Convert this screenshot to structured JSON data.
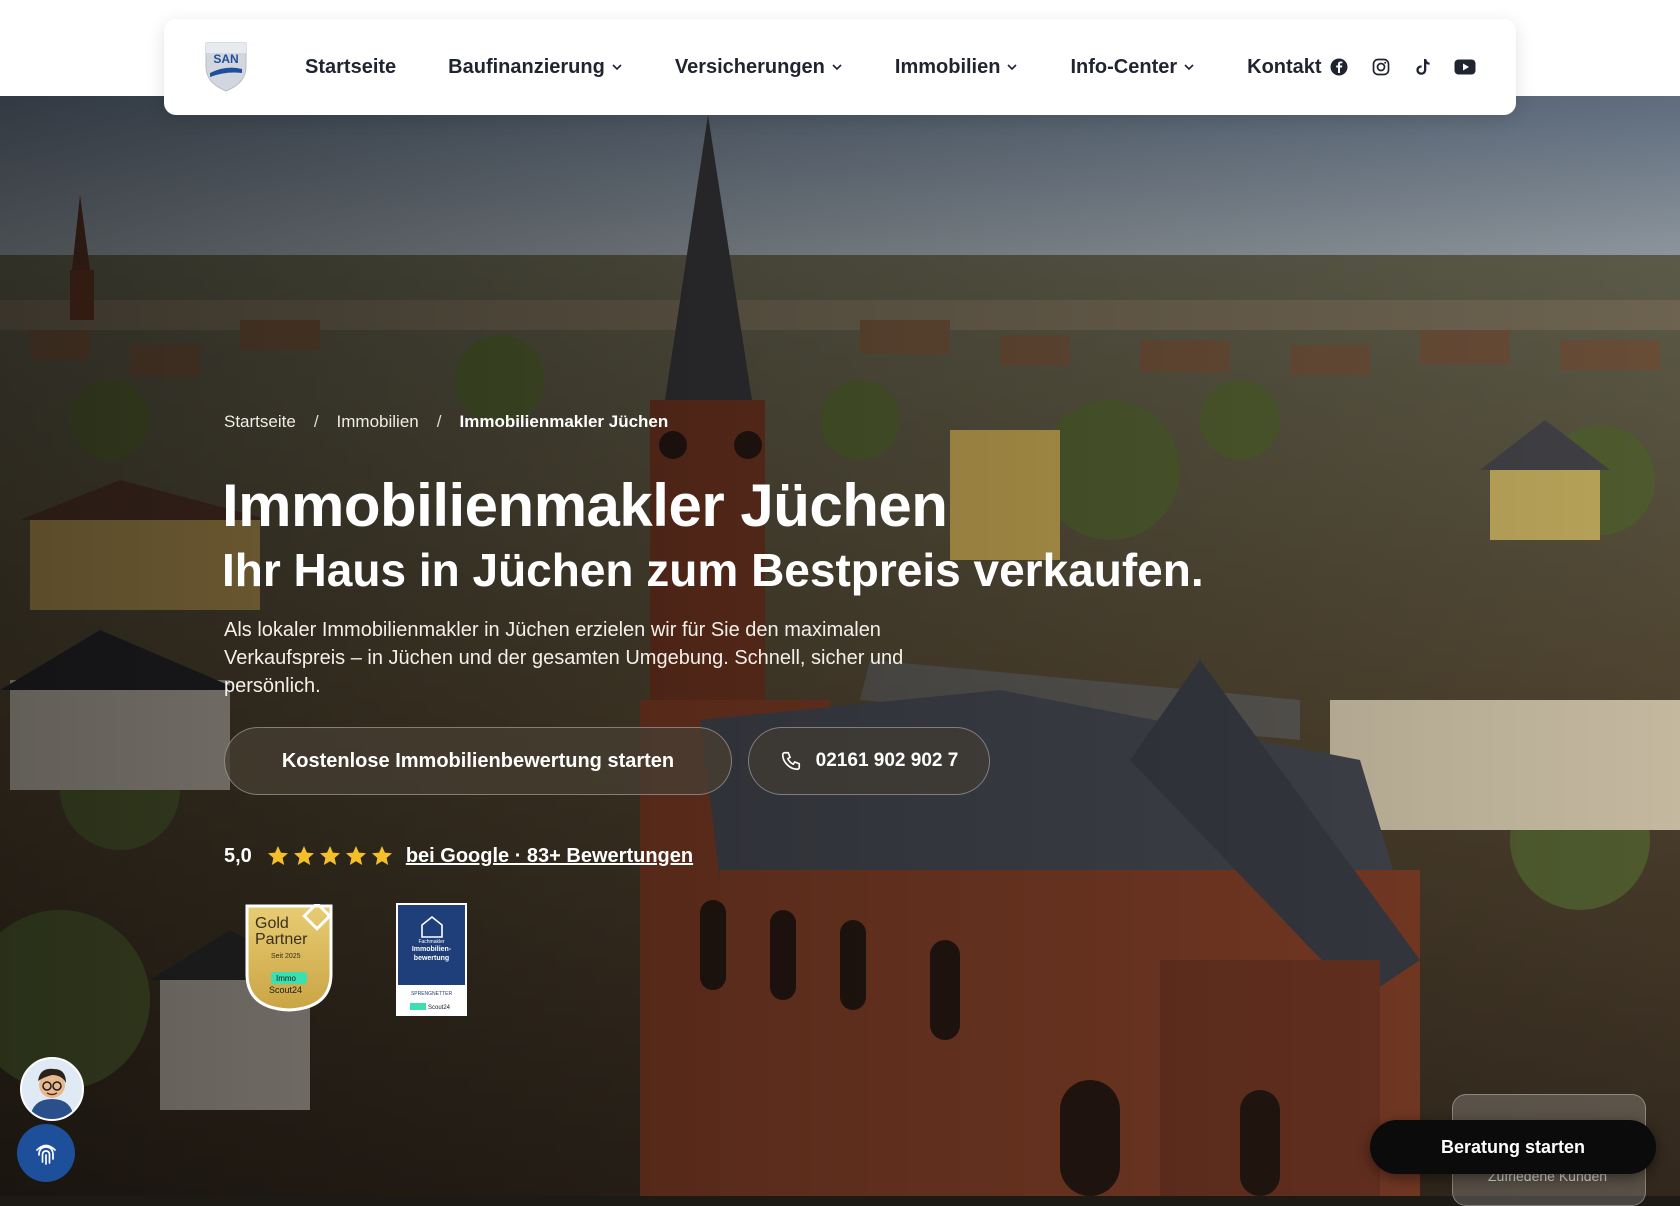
{
  "nav": {
    "logo_text": "SAN",
    "items": [
      {
        "label": "Startseite",
        "has_dropdown": false
      },
      {
        "label": "Baufinanzierung",
        "has_dropdown": true
      },
      {
        "label": "Versicherungen",
        "has_dropdown": true
      },
      {
        "label": "Immobilien",
        "has_dropdown": true
      },
      {
        "label": "Info-Center",
        "has_dropdown": true
      },
      {
        "label": "Kontakt",
        "has_dropdown": false
      }
    ],
    "socials": [
      "facebook-icon",
      "instagram-icon",
      "tiktok-icon",
      "youtube-icon"
    ]
  },
  "breadcrumb": {
    "items": [
      "Startseite",
      "Immobilien"
    ],
    "separator": "/",
    "current": "Immobilienmakler Jüchen"
  },
  "hero": {
    "title": "Immobilienmakler Jüchen",
    "subtitle": "Ihr Haus in Jüchen zum Bestpreis verkaufen.",
    "lead": "Als lokaler Immobilienmakler in Jüchen erzielen wir für Sie den maximalen Verkaufspreis – in Jüchen und der gesamten Umgebung. Schnell, sicher und persönlich.",
    "cta_primary": "Kostenlose Immobilienbewertung starten",
    "cta_phone": "02161 902 902 7"
  },
  "rating": {
    "score": "5,0",
    "stars": 5,
    "link": "bei Google · 83+ Bewertungen"
  },
  "badges": {
    "gold": {
      "line1": "Gold",
      "line2": "Partner",
      "since": "Seit 2025",
      "brand1": "Immo",
      "brand2": "Scout24"
    },
    "blue": {
      "line1": "Fachmakler",
      "line2": "Immobilien-",
      "line3": "bewertung",
      "issuer": "SPRENGNETTER",
      "brand": "Scout24"
    }
  },
  "floating": {
    "cta": "Beratung starten",
    "card_caption": "Zufriedene Kunden"
  },
  "colors": {
    "nav_text": "#1f2430",
    "accent_gold": "#f5bf2c",
    "badge_blue": "#1f3f7a",
    "fingerprint_bg": "#1e4f9a"
  }
}
